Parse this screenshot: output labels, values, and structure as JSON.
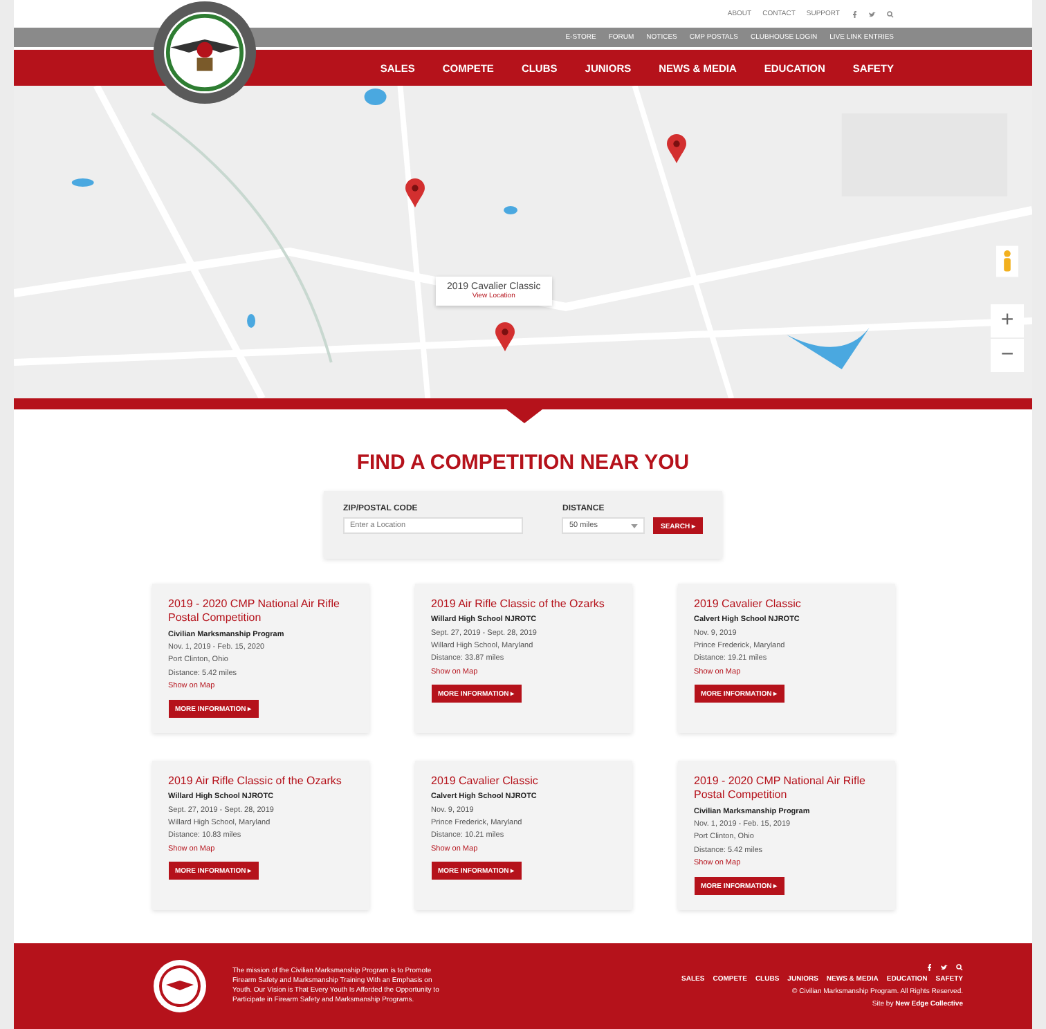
{
  "utility_links": [
    "ABOUT",
    "CONTACT",
    "SUPPORT"
  ],
  "secondary_nav": [
    "E-STORE",
    "FORUM",
    "NOTICES",
    "CMP POSTALS",
    "CLUBHOUSE LOGIN",
    "LIVE LINK ENTRIES"
  ],
  "main_nav": [
    "SALES",
    "COMPETE",
    "CLUBS",
    "JUNIORS",
    "NEWS & MEDIA",
    "EDUCATION",
    "SAFETY"
  ],
  "map": {
    "kind": "picture",
    "popup": {
      "title": "2019 Cavalier Classic",
      "link": "View Location"
    },
    "zoom_in": "+",
    "zoom_out": "−"
  },
  "search": {
    "heading": "FIND A COMPETITION NEAR YOU",
    "zip_label": "ZIP/POSTAL CODE",
    "zip_placeholder": "Enter a Location",
    "distance_label": "DISTANCE",
    "distance_value": "50 miles",
    "button": "SEARCH ▸"
  },
  "competitions": [
    {
      "title": "2019 - 2020 CMP National Air Rifle Postal Competition",
      "host": "Civilian Marksmanship Program",
      "dates": "Nov. 1, 2019 - Feb. 15, 2020",
      "place": "Port Clinton, Ohio",
      "distance": "Distance: 5.42 miles",
      "map_link": "Show on Map",
      "button": "MORE INFORMATION ▸"
    },
    {
      "title": "2019 Air Rifle Classic of the Ozarks",
      "host": "Willard High School NJROTC",
      "dates": "Sept. 27, 2019 - Sept. 28, 2019",
      "place": "Willard High School, Maryland",
      "distance": "Distance: 33.87 miles",
      "map_link": "Show on Map",
      "button": "MORE INFORMATION ▸"
    },
    {
      "title": "2019 Cavalier Classic",
      "host": "Calvert High School NJROTC",
      "dates": "Nov. 9, 2019",
      "place": "Prince Frederick, Maryland",
      "distance": "Distance: 19.21 miles",
      "map_link": "Show on Map",
      "button": "MORE INFORMATION ▸"
    },
    {
      "title": "2019 Air Rifle Classic of the Ozarks",
      "host": "Willard High School NJROTC",
      "dates": "Sept. 27, 2019 - Sept. 28, 2019",
      "place": "Willard High School, Maryland",
      "distance": "Distance: 10.83 miles",
      "map_link": "Show on Map",
      "button": "MORE INFORMATION ▸"
    },
    {
      "title": "2019 Cavalier Classic",
      "host": "Calvert High School NJROTC",
      "dates": "Nov. 9, 2019",
      "place": "Prince Frederick, Maryland",
      "distance": "Distance: 10.21 miles",
      "map_link": "Show on Map",
      "button": "MORE INFORMATION ▸"
    },
    {
      "title": "2019 - 2020 CMP National Air Rifle Postal Competition",
      "host": "Civilian Marksmanship Program",
      "dates": "Nov. 1, 2019 - Feb. 15, 2019",
      "place": "Port Clinton, Ohio",
      "distance": "Distance: 5.42 miles",
      "map_link": "Show on Map",
      "button": "MORE INFORMATION ▸"
    }
  ],
  "footer": {
    "mission": "The mission of the Civilian Marksmanship Program is to Promote Firearm Safety and Marksmanship Training With an Emphasis on Youth. Our Vision is That Every Youth Is Afforded the Opportunity to Participate in Firearm Safety and Marksmanship Programs.",
    "links": [
      "SALES",
      "COMPETE",
      "CLUBS",
      "JUNIORS",
      "NEWS & MEDIA",
      "EDUCATION",
      "SAFETY"
    ],
    "copyright": "© Civilian Marksmanship Program. All Rights Reserved.",
    "credit": "Site by **New Edge Collective**"
  }
}
